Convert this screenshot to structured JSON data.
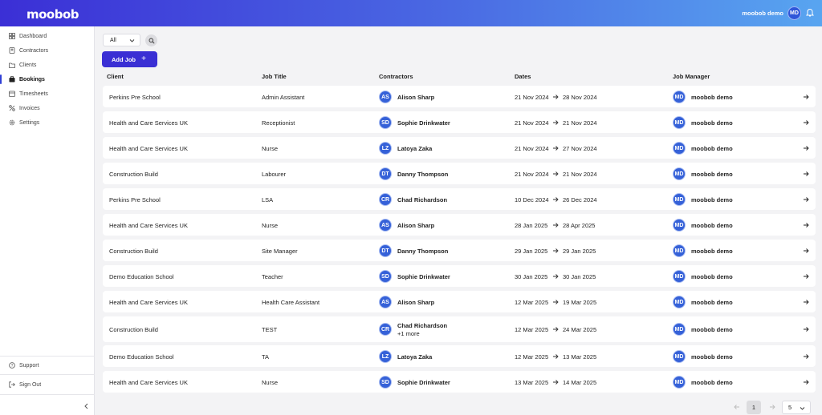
{
  "header": {
    "logo": "moobob",
    "user_name": "moobob demo",
    "user_initials": "MD"
  },
  "sidebar": {
    "items": [
      {
        "label": "Dashboard",
        "icon": "dashboard-icon"
      },
      {
        "label": "Contractors",
        "icon": "contractors-icon"
      },
      {
        "label": "Clients",
        "icon": "clients-icon"
      },
      {
        "label": "Bookings",
        "icon": "bookings-icon",
        "active": true
      },
      {
        "label": "Timesheets",
        "icon": "timesheets-icon"
      },
      {
        "label": "Invoices",
        "icon": "invoices-icon"
      },
      {
        "label": "Settings",
        "icon": "settings-icon"
      }
    ],
    "support": "Support",
    "sign_out": "Sign Out"
  },
  "toolbar": {
    "filter_value": "All",
    "add_job_label": "Add Job",
    "add_job_plus": "+"
  },
  "table": {
    "columns": [
      "Client",
      "Job Title",
      "Contractors",
      "Dates",
      "Job Manager"
    ],
    "rows": [
      {
        "client": "Perkins Pre School",
        "job": "Admin Assistant",
        "initials": "AS",
        "contractor": "Alison Sharp",
        "more": "",
        "start": "21 Nov 2024",
        "end": "28 Nov 2024",
        "mgr_initials": "MD",
        "manager": "moobob demo"
      },
      {
        "client": "Health and Care Services UK",
        "job": "Receptionist",
        "initials": "SD",
        "contractor": "Sophie Drinkwater",
        "more": "",
        "start": "21 Nov 2024",
        "end": "21 Nov 2024",
        "mgr_initials": "MD",
        "manager": "moobob demo"
      },
      {
        "client": "Health and Care Services UK",
        "job": "Nurse",
        "initials": "LZ",
        "contractor": "Latoya Zaka",
        "more": "",
        "start": "21 Nov 2024",
        "end": "27 Nov 2024",
        "mgr_initials": "MD",
        "manager": "moobob demo"
      },
      {
        "client": "Construction Build",
        "job": "Labourer",
        "initials": "DT",
        "contractor": "Danny Thompson",
        "more": "",
        "start": "21 Nov 2024",
        "end": "21 Nov 2024",
        "mgr_initials": "MD",
        "manager": "moobob demo"
      },
      {
        "client": "Perkins Pre School",
        "job": "LSA",
        "initials": "CR",
        "contractor": "Chad Richardson",
        "more": "",
        "start": "10 Dec 2024",
        "end": "26 Dec 2024",
        "mgr_initials": "MD",
        "manager": "moobob demo"
      },
      {
        "client": "Health and Care Services UK",
        "job": "Nurse",
        "initials": "AS",
        "contractor": "Alison Sharp",
        "more": "",
        "start": "28 Jan 2025",
        "end": "28 Apr 2025",
        "mgr_initials": "MD",
        "manager": "moobob demo"
      },
      {
        "client": "Construction Build",
        "job": "Site Manager",
        "initials": "DT",
        "contractor": "Danny Thompson",
        "more": "",
        "start": "29 Jan 2025",
        "end": "29 Jan 2025",
        "mgr_initials": "MD",
        "manager": "moobob demo"
      },
      {
        "client": "Demo Education School",
        "job": "Teacher",
        "initials": "SD",
        "contractor": "Sophie Drinkwater",
        "more": "",
        "start": "30 Jan 2025",
        "end": "30 Jan 2025",
        "mgr_initials": "MD",
        "manager": "moobob demo"
      },
      {
        "client": "Health and Care Services UK",
        "job": "Health Care Assistant",
        "initials": "AS",
        "contractor": "Alison Sharp",
        "more": "",
        "start": "12 Mar 2025",
        "end": "19 Mar 2025",
        "mgr_initials": "MD",
        "manager": "moobob demo"
      },
      {
        "client": "Construction Build",
        "job": "TEST",
        "initials": "CR",
        "contractor": "Chad Richardson",
        "more": "+1 more",
        "start": "12 Mar 2025",
        "end": "24 Mar 2025",
        "mgr_initials": "MD",
        "manager": "moobob demo"
      },
      {
        "client": "Demo Education School",
        "job": "TA",
        "initials": "LZ",
        "contractor": "Latoya Zaka",
        "more": "",
        "start": "12 Mar 2025",
        "end": "13 Mar 2025",
        "mgr_initials": "MD",
        "manager": "moobob demo"
      },
      {
        "client": "Health and Care Services UK",
        "job": "Nurse",
        "initials": "SD",
        "contractor": "Sophie Drinkwater",
        "more": "",
        "start": "13 Mar 2025",
        "end": "14 Mar 2025",
        "mgr_initials": "MD",
        "manager": "moobob demo"
      }
    ]
  },
  "pagination": {
    "current_page": "1",
    "page_size": "5"
  },
  "colors": {
    "accent": "#3a2fd4",
    "avatar": "#3561d8"
  }
}
